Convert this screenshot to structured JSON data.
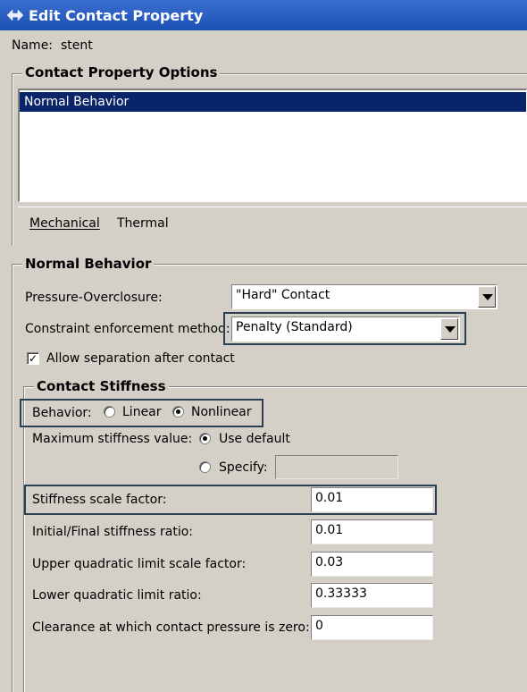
{
  "window": {
    "title": "Edit Contact Property"
  },
  "name_row": {
    "label": "Name:",
    "value": "stent"
  },
  "options_group": {
    "title": "Contact Property Options",
    "items": [
      "Normal Behavior"
    ],
    "menu": {
      "mechanical": "Mechanical",
      "thermal": "Thermal"
    }
  },
  "normal_group": {
    "title": "Normal Behavior",
    "pressure_label": "Pressure-Overclosure:",
    "pressure_value": "\"Hard\" Contact",
    "constraint_label": "Constraint enforcement method:",
    "constraint_value": "Penalty (Standard)",
    "allow_separation_label": "Allow separation after contact",
    "allow_separation_checked": true
  },
  "stiffness_group": {
    "title": "Contact Stiffness",
    "behavior_label": "Behavior:",
    "behavior_options": [
      "Linear",
      "Nonlinear"
    ],
    "behavior_selected": "Nonlinear",
    "max_stiffness_label": "Maximum stiffness value:",
    "use_default_label": "Use default",
    "specify_label": "Specify:",
    "specify_value": "",
    "fields": [
      {
        "label": "Stiffness scale factor:",
        "value": "0.01"
      },
      {
        "label": "Initial/Final stiffness ratio:",
        "value": "0.01"
      },
      {
        "label": "Upper quadratic limit scale factor:",
        "value": "0.03"
      },
      {
        "label": "Lower quadratic limit ratio:",
        "value": "0.33333"
      },
      {
        "label": "Clearance at which contact pressure is zero:",
        "value": "0"
      }
    ]
  },
  "colors": {
    "titlebar": "#1c4fb3",
    "dialog_bg": "#d4d0c8",
    "selection": "#0a246a",
    "highlight_box": "#2b3e52"
  }
}
